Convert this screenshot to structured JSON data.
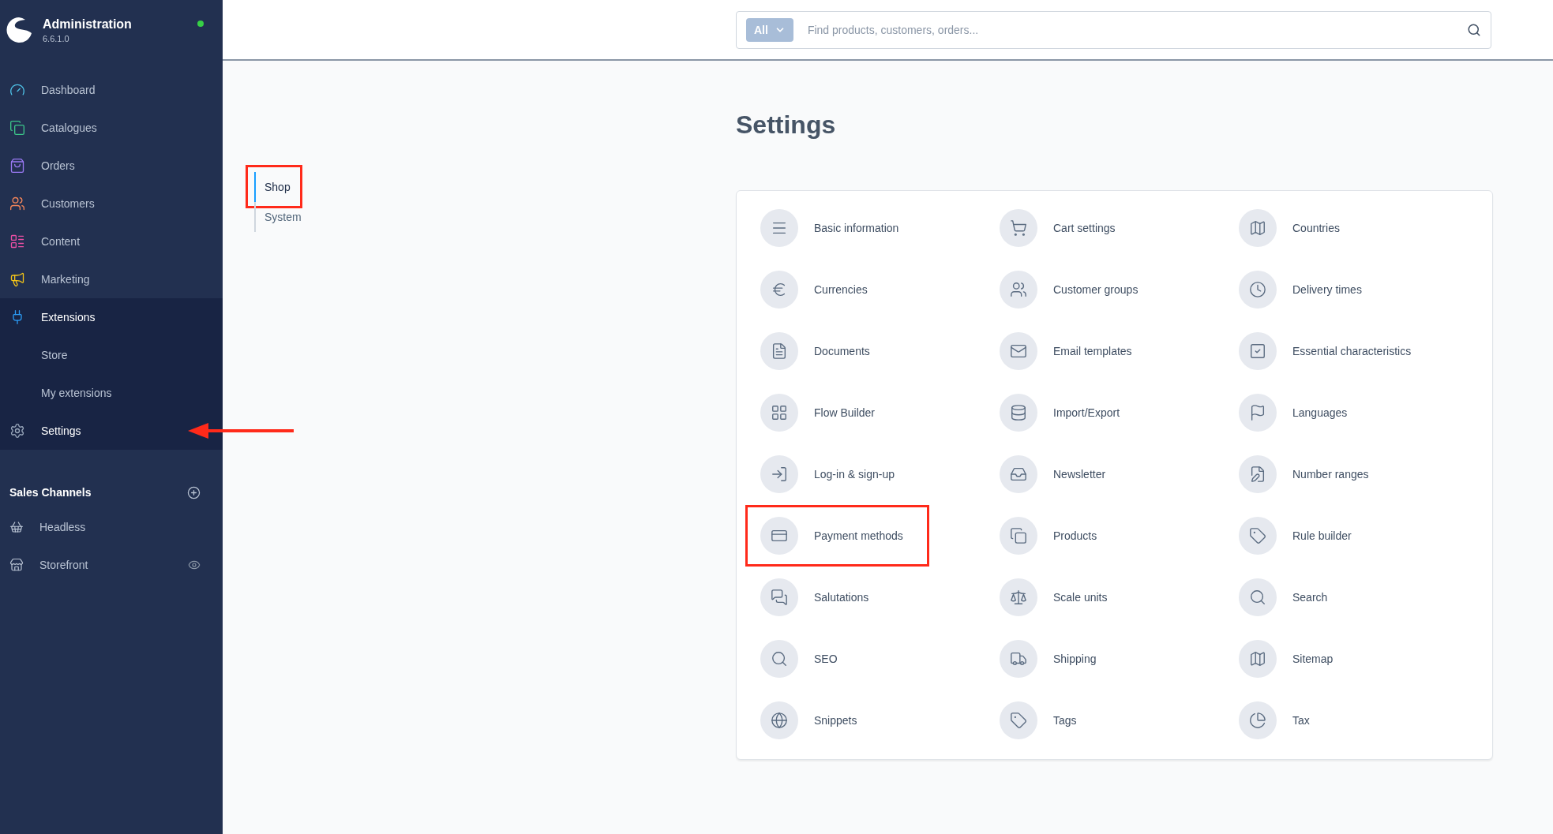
{
  "brand": {
    "title": "Administration",
    "version": "6.6.1.0",
    "online": true
  },
  "nav": [
    {
      "label": "Dashboard",
      "color": "#4fc3e8",
      "active": false,
      "highlighted": false
    },
    {
      "label": "Catalogues",
      "color": "#3cc68a",
      "active": false,
      "highlighted": false
    },
    {
      "label": "Orders",
      "color": "#9b7af5",
      "active": false,
      "highlighted": false
    },
    {
      "label": "Customers",
      "color": "#f3855a",
      "active": false,
      "highlighted": false
    },
    {
      "label": "Content",
      "color": "#ec4fa5",
      "active": false,
      "highlighted": false
    },
    {
      "label": "Marketing",
      "color": "#f5c518",
      "active": false,
      "highlighted": false
    },
    {
      "label": "Extensions",
      "color": "#2b9bf5",
      "active": true,
      "highlighted": false,
      "children": [
        {
          "label": "Store"
        },
        {
          "label": "My extensions"
        }
      ]
    },
    {
      "label": "Settings",
      "color": "#9aa8bc",
      "active": true,
      "highlighted": true
    }
  ],
  "sales_channels": {
    "title": "Sales Channels",
    "items": [
      {
        "label": "Headless",
        "visible_toggle": false
      },
      {
        "label": "Storefront",
        "visible_toggle": true
      }
    ]
  },
  "search": {
    "scope": "All",
    "placeholder": "Find products, customers, orders..."
  },
  "page_title": "Settings",
  "tabs": [
    {
      "label": "Shop",
      "selected": true,
      "highlighted": true
    },
    {
      "label": "System",
      "selected": false,
      "highlighted": false
    }
  ],
  "settings": [
    {
      "label": "Basic information",
      "highlighted": false
    },
    {
      "label": "Cart settings",
      "highlighted": false
    },
    {
      "label": "Countries",
      "highlighted": false
    },
    {
      "label": "Currencies",
      "highlighted": false
    },
    {
      "label": "Customer groups",
      "highlighted": false
    },
    {
      "label": "Delivery times",
      "highlighted": false
    },
    {
      "label": "Documents",
      "highlighted": false
    },
    {
      "label": "Email templates",
      "highlighted": false
    },
    {
      "label": "Essential characteristics",
      "highlighted": false
    },
    {
      "label": "Flow Builder",
      "highlighted": false
    },
    {
      "label": "Import/Export",
      "highlighted": false
    },
    {
      "label": "Languages",
      "highlighted": false
    },
    {
      "label": "Log-in & sign-up",
      "highlighted": false
    },
    {
      "label": "Newsletter",
      "highlighted": false
    },
    {
      "label": "Number ranges",
      "highlighted": false
    },
    {
      "label": "Payment methods",
      "highlighted": true
    },
    {
      "label": "Products",
      "highlighted": false
    },
    {
      "label": "Rule builder",
      "highlighted": false
    },
    {
      "label": "Salutations",
      "highlighted": false
    },
    {
      "label": "Scale units",
      "highlighted": false
    },
    {
      "label": "Search",
      "highlighted": false
    },
    {
      "label": "SEO",
      "highlighted": false
    },
    {
      "label": "Shipping",
      "highlighted": false
    },
    {
      "label": "Sitemap",
      "highlighted": false
    },
    {
      "label": "Snippets",
      "highlighted": false
    },
    {
      "label": "Tags",
      "highlighted": false
    },
    {
      "label": "Tax",
      "highlighted": false
    }
  ]
}
